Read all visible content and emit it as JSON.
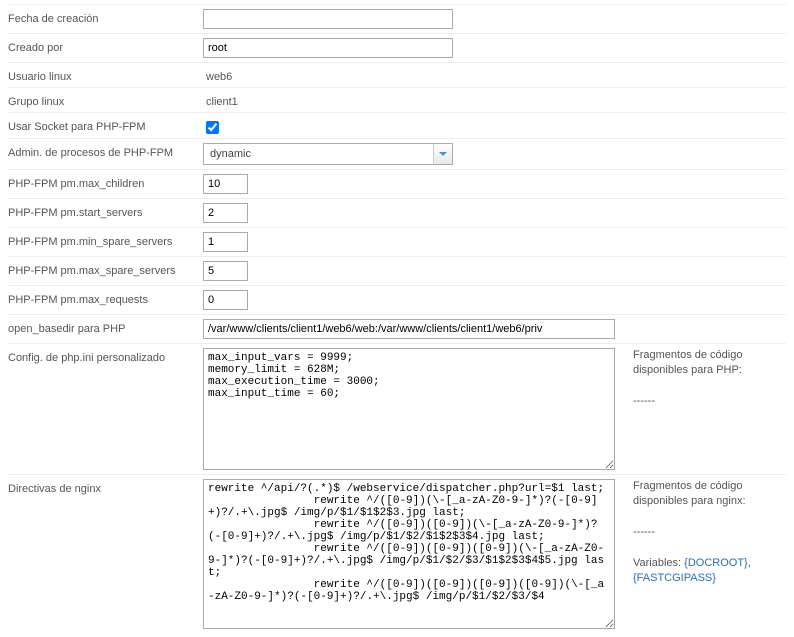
{
  "rows": {
    "fecha_creacion": {
      "label": "Fecha de creación",
      "value": ""
    },
    "creado_por": {
      "label": "Creado por",
      "value": "root"
    },
    "usuario_linux": {
      "label": "Usuario linux",
      "value": "web6"
    },
    "grupo_linux": {
      "label": "Grupo linux",
      "value": "client1"
    },
    "socket_fpm": {
      "label": "Usar Socket para PHP-FPM",
      "checked": true
    },
    "pm_mode": {
      "label": "Admin. de procesos de PHP-FPM",
      "value": "dynamic"
    },
    "pm_max_children": {
      "label": "PHP-FPM pm.max_children",
      "value": "10"
    },
    "pm_start_servers": {
      "label": "PHP-FPM pm.start_servers",
      "value": "2"
    },
    "pm_min_spare": {
      "label": "PHP-FPM pm.min_spare_servers",
      "value": "1"
    },
    "pm_max_spare": {
      "label": "PHP-FPM pm.max_spare_servers",
      "value": "5"
    },
    "pm_max_requests": {
      "label": "PHP-FPM pm.max_requests",
      "value": "0"
    },
    "open_basedir": {
      "label": "open_basedir para PHP",
      "value": "/var/www/clients/client1/web6/web:/var/www/clients/client1/web6/priv"
    },
    "php_ini": {
      "label": "Config. de php.ini personalizado",
      "value": "max_input_vars = 9999;\nmemory_limit = 628M;\nmax_execution_time = 3000;\nmax_input_time = 60;"
    },
    "nginx": {
      "label": "Directivas de nginx",
      "value": "rewrite ^/api/?(.*)$ /webservice/dispatcher.php?url=$1 last;\n                rewrite ^/([0-9])(\\-[_a-zA-Z0-9-]*)?(-[0-9]+)?/.+\\.jpg$ /img/p/$1/$1$2$3.jpg last;\n                rewrite ^/([0-9])([0-9])(\\-[_a-zA-Z0-9-]*)?(-[0-9]+)?/.+\\.jpg$ /img/p/$1/$2/$1$2$3$4.jpg last;\n                rewrite ^/([0-9])([0-9])([0-9])(\\-[_a-zA-Z0-9-]*)?(-[0-9]+)?/.+\\.jpg$ /img/p/$1/$2/$3/$1$2$3$4$5.jpg last;\n                rewrite ^/([0-9])([0-9])([0-9])([0-9])(\\-[_a-zA-Z0-9-]*)?(-[0-9]+)?/.+\\.jpg$ /img/p/$1/$2/$3/$4"
    }
  },
  "side": {
    "php": {
      "title": "Fragmentos de código disponibles para PHP:",
      "dash": "------"
    },
    "nginx": {
      "title": "Fragmentos de código disponibles para nginx:",
      "dash": "------",
      "vars_label": "Variables: ",
      "var1": "{DOCROOT}",
      "comma": ", ",
      "var2": "{FASTCGIPASS}"
    }
  }
}
